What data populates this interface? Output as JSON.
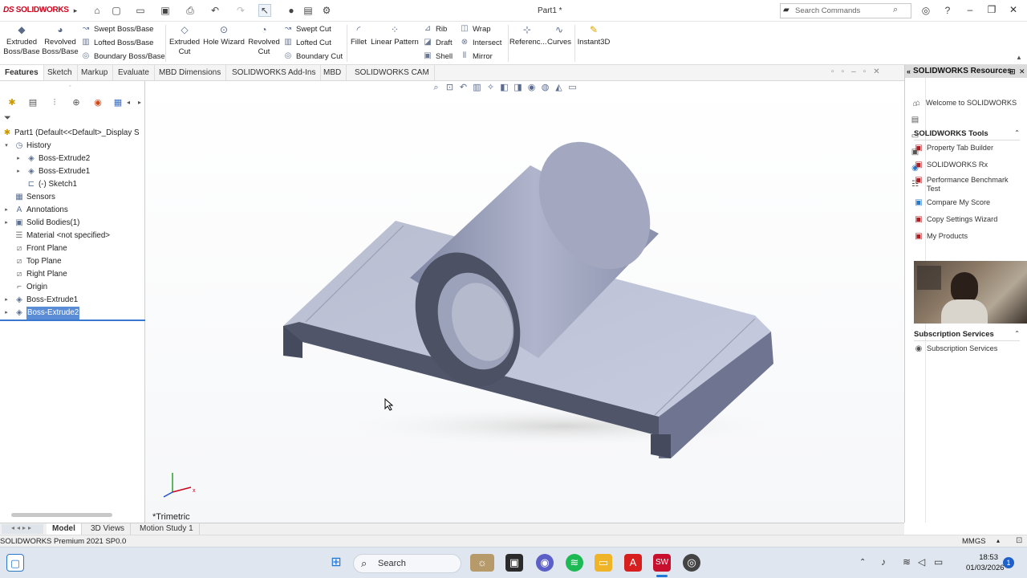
{
  "titlebar": {
    "app_logo": "SOLIDWORKS",
    "doc_title": "Part1 *",
    "search_placeholder": "Search Commands"
  },
  "ribbon": {
    "extruded_boss": "Extruded Boss/Base",
    "revolved_boss": "Revolved Boss/Base",
    "swept_boss": "Swept Boss/Base",
    "lofted_boss": "Lofted Boss/Base",
    "boundary_boss": "Boundary Boss/Base",
    "extruded_cut": "Extruded Cut",
    "hole_wizard": "Hole Wizard",
    "revolved_cut": "Revolved Cut",
    "swept_cut": "Swept Cut",
    "lofted_cut": "Lofted Cut",
    "boundary_cut": "Boundary Cut",
    "fillet": "Fillet",
    "linear_pattern": "Linear Pattern",
    "rib": "Rib",
    "draft": "Draft",
    "shell": "Shell",
    "wrap": "Wrap",
    "intersect": "Intersect",
    "mirror": "Mirror",
    "reference": "Referenc...",
    "curves": "Curves",
    "instant3d": "Instant3D"
  },
  "cmd_tabs": [
    "Features",
    "Sketch",
    "Markup",
    "Evaluate",
    "MBD Dimensions",
    "SOLIDWORKS Add-Ins",
    "MBD",
    "SOLIDWORKS CAM"
  ],
  "tree": {
    "root": "Part1  (Default<<Default>_Display S",
    "history": "History",
    "h_boss2": "Boss-Extrude2",
    "h_boss1": "Boss-Extrude1",
    "h_sketch1": "(-) Sketch1",
    "sensors": "Sensors",
    "annotations": "Annotations",
    "solid_bodies": "Solid Bodies(1)",
    "material": "Material <not specified>",
    "front_plane": "Front Plane",
    "top_plane": "Top Plane",
    "right_plane": "Right Plane",
    "origin": "Origin",
    "boss1": "Boss-Extrude1",
    "boss2": "Boss-Extrude2"
  },
  "viewport": {
    "view_label": "*Trimetric"
  },
  "taskpane": {
    "title": "SOLIDWORKS Resources",
    "welcome": "Welcome to SOLIDWORKS",
    "tools_header": "SOLIDWORKS Tools",
    "tools": [
      "Property Tab Builder",
      "SOLIDWORKS Rx",
      "Performance Benchmark Test",
      "Compare My Score",
      "Copy Settings Wizard",
      "My Products"
    ],
    "sub_header": "Subscription Services",
    "sub_item": "Subscription Services"
  },
  "bottom_tabs": [
    "Model",
    "3D Views",
    "Motion Study 1"
  ],
  "status": {
    "left": "SOLIDWORKS Premium 2021 SP0.0",
    "units": "MMGS"
  },
  "taskbar": {
    "search": "Search",
    "time": "18:53",
    "date": "01/03/2026",
    "notifications": "1"
  },
  "colors": {
    "brand": "#d0021b",
    "selection": "#5b8dd6",
    "model_face": "#a9afc6"
  }
}
